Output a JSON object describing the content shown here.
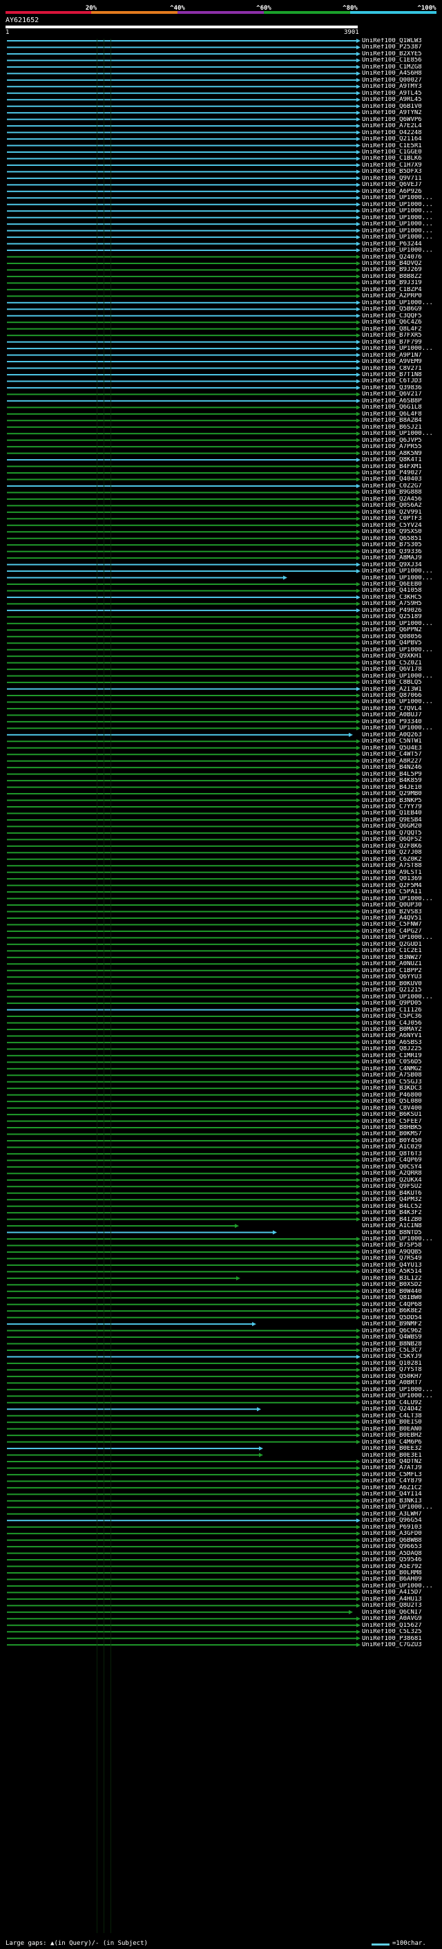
{
  "legend": {
    "ticks": [
      "20%",
      "^40%",
      "^60%",
      "^80%",
      "^100%"
    ],
    "colors": [
      "#d8143a",
      "#e27a1e",
      "#8c2fa8",
      "#1aa02a",
      "#35c4e0"
    ]
  },
  "query": {
    "id": "AY621652",
    "start": "1",
    "end": "3901"
  },
  "hit_colors": {
    "cyan": "#4fc8e8",
    "green": "#1f9a2a",
    "purple": "#b02aa8"
  },
  "hits": [
    "UniRef100_Q1WLW3",
    "UniRef100_P25387",
    "UniRef100_B2XYE5",
    "UniRef100_C1E856",
    "UniRef100_C1MZG8",
    "UniRef100_A4S6H8",
    "UniRef100_Q00027",
    "UniRef100_A9TMY3",
    "UniRef100_A9TL45",
    "UniRef100_A9RL45",
    "UniRef100_Q6B1V0",
    "UniRef100_A9TYN2",
    "UniRef100_Q6WVP6",
    "UniRef100_A7E2L4",
    "UniRef100_O42248",
    "UniRef100_Q21164",
    "UniRef100_C1E5R1",
    "UniRef100_C1GGE0",
    "UniRef100_C1BLK6",
    "UniRef100_C1H7X9",
    "UniRef100_B5DFX3",
    "UniRef100_Q9V711",
    "UniRef100_Q6VEJ7",
    "UniRef100_A6P926",
    "UniRef100_UP1000...",
    "UniRef100_UP1000...",
    "UniRef100_UP1000...",
    "UniRef100_UP1000...",
    "UniRef100_UP1000...",
    "UniRef100_UP1000...",
    "UniRef100_UP1000...",
    "UniRef100_P63244",
    "UniRef100_UP1000...",
    "UniRef100_Q24076",
    "UniRef100_B4DVQ2",
    "UniRef100_B9J269",
    "UniRef100_B8B8Z2",
    "UniRef100_B9J319",
    "UniRef100_C1BZP4",
    "UniRef100_A2PRP0",
    "UniRef100_UP1000...",
    "UniRef100_Q5B6G9",
    "UniRef100_C3QQF5",
    "UniRef100_Q6C4Z6",
    "UniRef100_Q8L4F2",
    "UniRef100_B7FXR5",
    "UniRef100_B7F799",
    "UniRef100_UP1000...",
    "UniRef100_A9P1N7",
    "UniRef100_A9VEM9",
    "UniRef100_C8V271",
    "UniRef100_B7T1N8",
    "UniRef100_C6TJD3",
    "UniRef100_Q39836",
    "UniRef100_Q6V217",
    "UniRef100_A6SB8P",
    "UniRef100_Q6G1L8",
    "UniRef100_Q6L4F8",
    "UniRef100_B8A2B4",
    "UniRef100_B6SJ21",
    "UniRef100_UP1000...",
    "UniRef100_Q6JVP5",
    "UniRef100_A7PR55",
    "UniRef100_A8K5N9",
    "UniRef100_Q8K4T1",
    "UniRef100_B4FXM1",
    "UniRef100_P49027",
    "UniRef100_Q40403",
    "UniRef100_C0Z2G7",
    "UniRef100_B9G888",
    "UniRef100_Q2A456",
    "UniRef100_Q0S6A2",
    "UniRef100_Q2V991",
    "UniRef100_C0PTF3",
    "UniRef100_C5YV24",
    "UniRef100_Q9SXS0",
    "UniRef100_Q65851",
    "UniRef100_B7S305",
    "UniRef100_Q39336",
    "UniRef100_A8MAJ9",
    "UniRef100_Q9XJ34",
    "UniRef100_UP1000...",
    "UniRef100_UP1000...",
    "UniRef100_Q6EEB0",
    "UniRef100_Q41058",
    "UniRef100_C3KHC5",
    "UniRef100_A7S9H5",
    "UniRef100_P49026",
    "UniRef100_Q25189",
    "UniRef100_UP1000...",
    "UniRef100_Q6PPN2",
    "UniRef100_Q08056",
    "UniRef100_Q4PBV5",
    "UniRef100_UP1000...",
    "UniRef100_Q9XKH1",
    "UniRef100_C5Z0Z1",
    "UniRef100_Q6V178",
    "UniRef100_UP1000...",
    "UniRef100_C8BLQ5",
    "UniRef100_A2I3W1",
    "UniRef100_Q87066",
    "UniRef100_UP1000...",
    "UniRef100_C7QVL4",
    "UniRef100_A0BUJ7",
    "UniRef100_P93340",
    "UniRef100_UP1000...",
    "UniRef100_A0Q263",
    "UniRef100_C5NTW1",
    "UniRef100_Q5U4E3",
    "UniRef100_C4WT57",
    "UniRef100_A8R227",
    "UniRef100_B4N246",
    "UniRef100_B4L5P9",
    "UniRef100_B4K859",
    "UniRef100_B4JE10",
    "UniRef100_Q29MB0",
    "UniRef100_B3NKP5",
    "UniRef100_C7YY79",
    "UniRef100_Q1EB40",
    "UniRef100_Q9ESB4",
    "UniRef100_Q6GM20",
    "UniRef100_Q7QQT5",
    "UniRef100_Q6QFS2",
    "UniRef100_Q2F8K6",
    "UniRef100_Q27J08",
    "UniRef100_C6Z0K2",
    "UniRef100_A7ST88",
    "UniRef100_A9LST1",
    "UniRef100_Q01369",
    "UniRef100_Q2F5M4",
    "UniRef100_C5PAI1",
    "UniRef100_UP1000...",
    "UniRef100_Q0UP30",
    "UniRef100_B2VS83",
    "UniRef100_A4QV51",
    "UniRef100_C5FNW7",
    "UniRef100_C4PG27",
    "UniRef100_UP1000...",
    "UniRef100_Q2GUD1",
    "UniRef100_C1C2E1",
    "UniRef100_B3NW27",
    "UniRef100_A0NUZ1",
    "UniRef100_C1BPP2",
    "UniRef100_Q6YYU3",
    "UniRef100_B0KUV0",
    "UniRef100_Q21215",
    "UniRef100_UP1000...",
    "UniRef100_Q9PD05",
    "UniRef100_C1I126",
    "UniRef100_C5PC36",
    "UniRef100_C4J056",
    "UniRef100_B0MAY2",
    "UniRef100_A6NYV1",
    "UniRef100_A6SBS3",
    "UniRef100_Q8J225",
    "UniRef100_C1MRI9",
    "UniRef100_C0S6D5",
    "UniRef100_C4NMG2",
    "UniRef100_A7SB08",
    "UniRef100_C5SGJ3",
    "UniRef100_B3KDC3",
    "UniRef100_P46800",
    "UniRef100_Q5L080",
    "UniRef100_C8V400",
    "UniRef100_B6KSU1",
    "UniRef100_C5FEE7",
    "UniRef100_B8HBK5",
    "UniRef100_B0KMS7",
    "UniRef100_B0Y450",
    "UniRef100_A1C029",
    "UniRef100_Q8T6T3",
    "UniRef100_C4QP69",
    "UniRef100_Q0CSY4",
    "UniRef100_A2QRR8",
    "UniRef100_Q2UKX4",
    "UniRef100_Q9FSU2",
    "UniRef100_B4KUT6",
    "UniRef100_Q4PM32",
    "UniRef100_B4LC52",
    "UniRef100_B4K3F2",
    "UniRef100_B4IZB0",
    "UniRef100_A1CIN8",
    "UniRef100_B8NTD5",
    "UniRef100_UP1000...",
    "UniRef100_B7SP58",
    "UniRef100_A9QQB5",
    "UniRef100_Q7RS49",
    "UniRef100_Q4YU13",
    "UniRef100_A5K514",
    "UniRef100_B3L122",
    "UniRef100_B0XSD2",
    "UniRef100_B0W440",
    "UniRef100_Q8IBW0",
    "UniRef100_C4QP68",
    "UniRef100_B6K8E2",
    "UniRef100_Q5DD54",
    "UniRef100_B9NMF2",
    "UniRef100_Q6C962",
    "UniRef100_Q4WBS9",
    "UniRef100_B8NB28",
    "UniRef100_C5L3C7",
    "UniRef100_C5KYJ9",
    "UniRef100_Q10281",
    "UniRef100_Q7YST8",
    "UniRef100_Q50KH7",
    "UniRef100_A0BRT7",
    "UniRef100_UP1000...",
    "UniRef100_UP1000...",
    "UniRef100_C4LU92",
    "UniRef100_Q24D42",
    "UniRef100_C4LT38",
    "UniRef100_B0EIS0",
    "UniRef100_B0EAN0",
    "UniRef100_B0EBH2",
    "UniRef100_C4M6P6",
    "UniRef100_B0EE32",
    "UniRef100_B0E3E1",
    "UniRef100_Q4DTN2",
    "UniRef100_A7ATJ9",
    "UniRef100_C5MFL3",
    "UniRef100_C4Y879",
    "UniRef100_A6Z1C2",
    "UniRef100_Q4YI14",
    "UniRef100_B3NKI3",
    "UniRef100_UP1000...",
    "UniRef100_A3LWH7",
    "UniRef100_Q96G54",
    "UniRef100_P69103",
    "UniRef100_A3GFD0",
    "UniRef100_Q6BWB8",
    "UniRef100_Q96653",
    "UniRef100_A5DAQ8",
    "UniRef100_Q59546",
    "UniRef100_A5E792",
    "UniRef100_B0LRM8",
    "UniRef100_B6AH09",
    "UniRef100_UP1000...",
    "UniRef100_A4I5D7",
    "UniRef100_A4HU13",
    "UniRef100_Q8U2T3",
    "UniRef100_Q6CNI7",
    "UniRef100_A0AVG9",
    "UniRef100_Q15627",
    "UniRef100_C5L325",
    "UniRef100_P38681",
    "UniRef100_C7GZU3"
  ],
  "footer": {
    "gap_text": "Large gaps: ▲(in Query)/- (in Subject)",
    "scale_text": "=100char."
  }
}
